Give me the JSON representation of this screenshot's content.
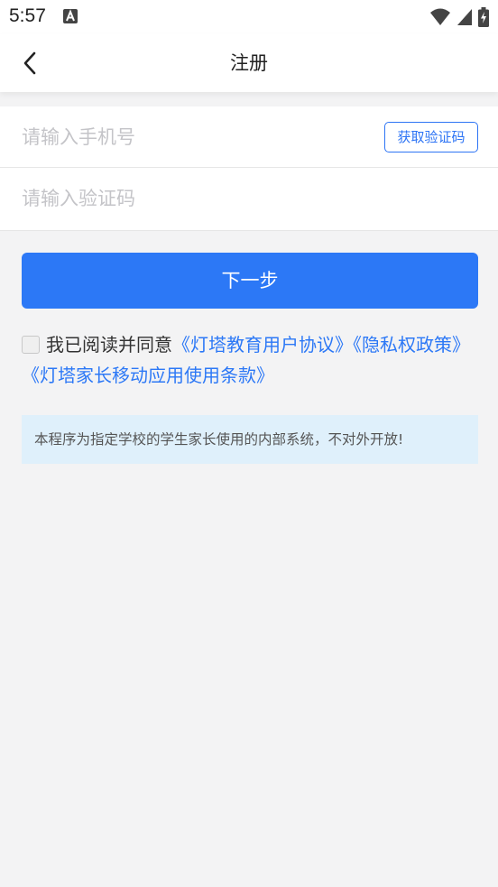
{
  "status_bar": {
    "time": "5:57",
    "icons": [
      "text-a-icon",
      "wifi-icon",
      "signal-icon",
      "battery-charging-icon"
    ]
  },
  "nav": {
    "title": "注册",
    "back_icon": "chevron-left-icon"
  },
  "form": {
    "phone_placeholder": "请输入手机号",
    "phone_value": "",
    "code_placeholder": "请输入验证码",
    "code_value": "",
    "get_code_label": "获取验证码"
  },
  "next_button": "下一步",
  "agreement": {
    "checked": false,
    "prefix": "我已阅读并同意",
    "link1": "《灯塔教育用户协议》",
    "link2": "《隐私权政策》",
    "link3": "《灯塔家长移动应用使用条款》"
  },
  "notice": "本程序为指定学校的学生家长使用的内部系统，不对外开放!",
  "colors": {
    "accent": "#2c78f6",
    "background": "#f3f3f4",
    "notice_bg": "#dff0fb"
  }
}
